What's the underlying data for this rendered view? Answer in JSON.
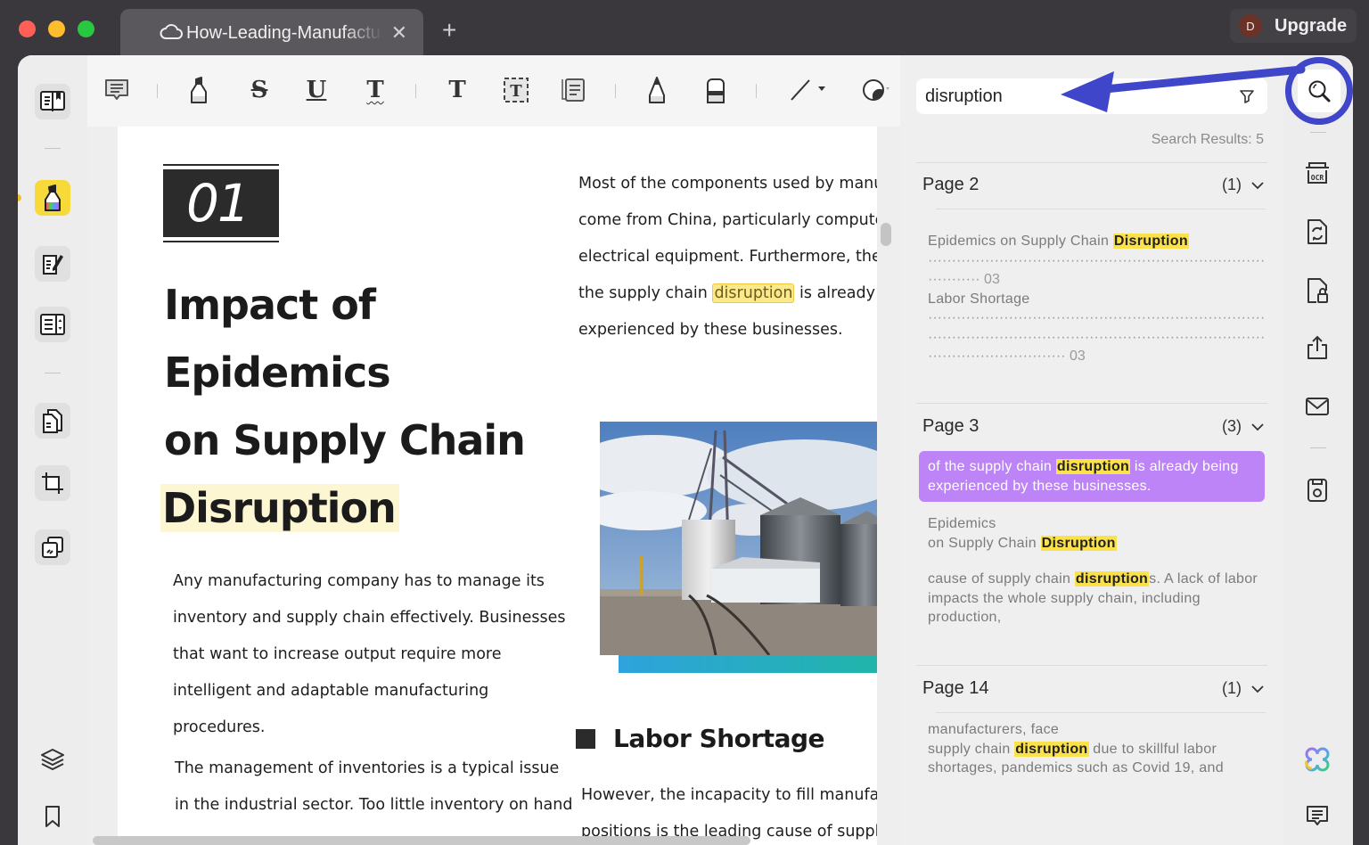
{
  "window": {
    "tab_title": "How-Leading-Manufacturers",
    "tab_close": "✕",
    "tab_add": "+",
    "upgrade_label": "Upgrade",
    "avatar_initial": "D"
  },
  "left_sidebar": {
    "items": [
      {
        "name": "reader-mode",
        "active": false
      },
      {
        "name": "comment-highlight",
        "active": true
      },
      {
        "name": "edit-pdf",
        "active": false
      },
      {
        "name": "form",
        "active": false
      },
      {
        "name": "organize-pages",
        "active": false
      },
      {
        "name": "crop",
        "active": false
      },
      {
        "name": "watermark",
        "active": false
      }
    ],
    "bottom": [
      "layers",
      "bookmark"
    ]
  },
  "toolbar": {
    "tools": [
      "comment",
      "highlight",
      "strikethrough",
      "underline",
      "squiggly",
      "text",
      "text-box",
      "text-callout",
      "pencil",
      "eraser",
      "line-shape",
      "sticker"
    ],
    "strike_glyph": "S",
    "underline_glyph": "U",
    "squiggly_glyph": "T",
    "text_glyph": "T"
  },
  "document": {
    "section_number": "01",
    "title_lines": [
      "Impact of",
      "Epidemics",
      "on Supply Chain"
    ],
    "title_highlight": "Disruption",
    "right_para": {
      "lines": [
        "Most of the components used by manufa",
        "come from China, particularly computer a",
        "electrical equipment. Furthermore, the in"
      ],
      "line4_pre": "the supply chain ",
      "line4_match": "disruption",
      "line4_post": " is already bei",
      "line5": "experienced by these businesses."
    },
    "left_para1": [
      "Any manufacturing company has to manage its",
      "inventory and supply chain effectively. Businesses",
      "that want to increase output require more",
      "intelligent and adaptable manufacturing",
      "procedures."
    ],
    "left_para2": [
      "The management of inventories is a typical issue",
      "in the industrial sector. Too little inventory on hand"
    ],
    "heading2": "Labor Shortage",
    "right_para2": [
      "However, the incapacity to fill manufactu",
      "positions is the leading cause of supply c"
    ],
    "image_alt": "grain silos photo"
  },
  "search": {
    "query": "disruption",
    "results_label": "Search Results: 5",
    "groups": [
      {
        "page": "Page 2",
        "count": "(1)",
        "snippets": [
          {
            "pre": "Epidemics  on  Supply  Chain  ",
            "match": "Disruption",
            "dots1": "··························································································",
            "line2": "··········· 03",
            "line3": "Labor  Shortage",
            "dots2": "··························································································",
            "dots3": "··························································································",
            "line6": "····························· 03"
          }
        ]
      },
      {
        "page": "Page 3",
        "count": "(3)",
        "snippets": [
          {
            "pre": "of the supply chain ",
            "match": "disruption",
            "post": " is already being experienced by these businesses.",
            "selected": true
          },
          {
            "pre": "Epidemics",
            "pre2": "on Supply Chain ",
            "match": "Disruption"
          },
          {
            "pre": "cause of supply chain ",
            "match": "disruption",
            "post": "s. A lack of labor impacts the whole supply chain, including production,"
          }
        ]
      },
      {
        "page": "Page 14",
        "count": "(1)",
        "snippets": [
          {
            "pre": "manufacturers, face",
            "pre2": "supply chain ",
            "match": "disruption",
            "post": " due to skillful labor shortages, pandemics such as Covid 19, and"
          }
        ]
      }
    ]
  },
  "right_sidebar": {
    "items": [
      "search",
      "ocr",
      "convert",
      "protect",
      "share",
      "email",
      "save",
      "ai-assistant",
      "comments"
    ],
    "ocr_label": "OCR"
  },
  "colors": {
    "accent_yellow": "#f7d939",
    "selected_result": "#bc84f6",
    "match_highlight": "#fbe14a",
    "annotation_blue": "#3f46c9"
  }
}
